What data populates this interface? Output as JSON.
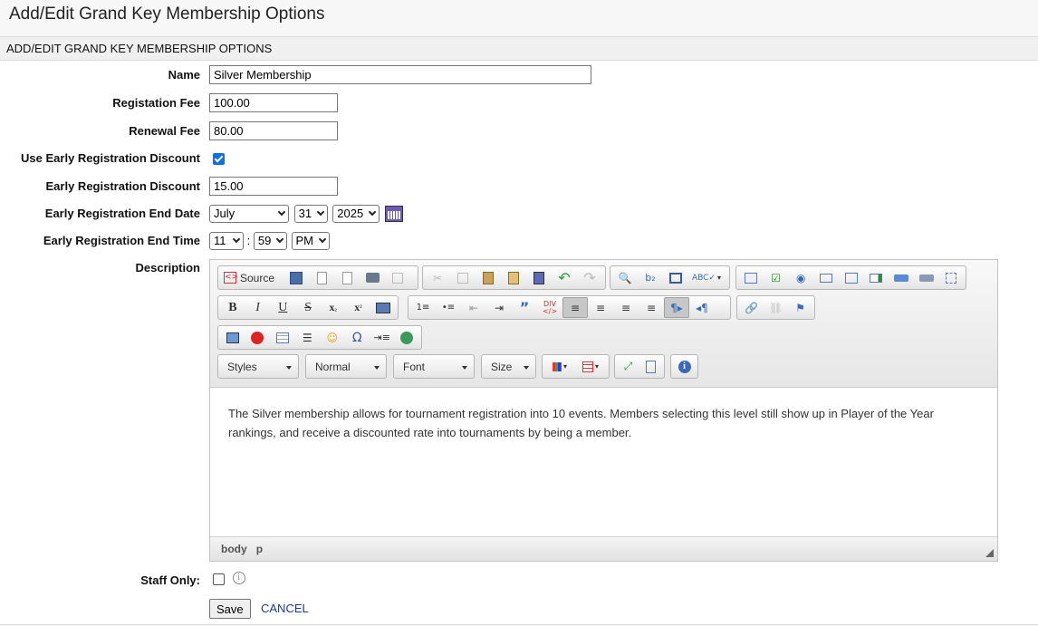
{
  "page": {
    "title": "Add/Edit Grand Key Membership Options"
  },
  "panel": {
    "header": "ADD/EDIT GRAND KEY MEMBERSHIP OPTIONS"
  },
  "form": {
    "name_label": "Name",
    "name_value": "Silver Membership",
    "reg_fee_label": "Registation Fee",
    "reg_fee_value": "100.00",
    "renewal_fee_label": "Renewal Fee",
    "renewal_fee_value": "80.00",
    "use_early_label": "Use Early Registration Discount",
    "use_early_checked": true,
    "early_discount_label": "Early Registration Discount",
    "early_discount_value": "15.00",
    "end_date_label": "Early Registration End Date",
    "end_date_month": "July",
    "end_date_day": "31",
    "end_date_year": "2025",
    "end_time_label": "Early Registration End Time",
    "end_time_hour": "11",
    "end_time_sep": ":",
    "end_time_minute": "59",
    "end_time_ampm": "PM",
    "description_label": "Description",
    "staff_only_label": "Staff Only:",
    "staff_only_checked": false,
    "save_label": "Save",
    "cancel_label": "CANCEL"
  },
  "editor": {
    "source_label": "Source",
    "combos": {
      "styles": "Styles",
      "format": "Normal",
      "font": "Font",
      "size": "Size"
    },
    "content": "The Silver membership allows for tournament registration into 10 events. Members selecting this level still show up in Player of the Year rankings, and receive a discounted rate into tournaments by being a member.",
    "status_path": [
      "body",
      "p"
    ]
  },
  "colors": {
    "accent": "#0b6fe8",
    "link": "#1a3a9a"
  }
}
